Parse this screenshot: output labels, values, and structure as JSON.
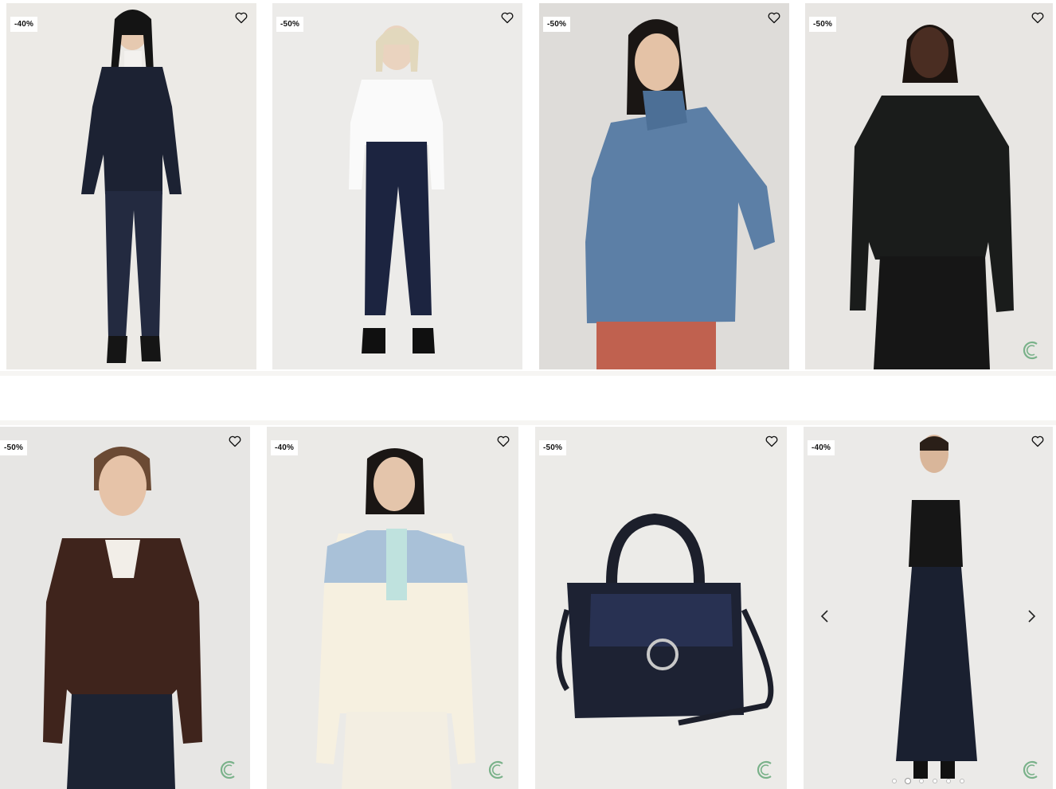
{
  "products": [
    {
      "discount": "-40%",
      "description": "navy peacoat with dark jeans"
    },
    {
      "discount": "-50%",
      "description": "white shirt with dark cropped jeans"
    },
    {
      "discount": "-50%",
      "description": "blue denim jacket"
    },
    {
      "discount": "-50%",
      "description": "black leather biker jacket"
    },
    {
      "discount": "-50%",
      "description": "brown leather biker jacket"
    },
    {
      "discount": "-40%",
      "description": "cream sweatshirt with denim yoke"
    },
    {
      "discount": "-50%",
      "description": "navy handbag with ring clasp"
    },
    {
      "discount": "-40%",
      "description": "black pleated slip dress"
    }
  ],
  "colors": {
    "background": "#e9e8e5",
    "badge_bg": "#ffffff",
    "logo_green": "#7ab28a"
  },
  "icons": {
    "wishlist": "heart-outline-icon",
    "prev": "chevron-left-icon",
    "next": "chevron-right-icon"
  },
  "carousel": {
    "slides": 6,
    "active_index": 1
  }
}
